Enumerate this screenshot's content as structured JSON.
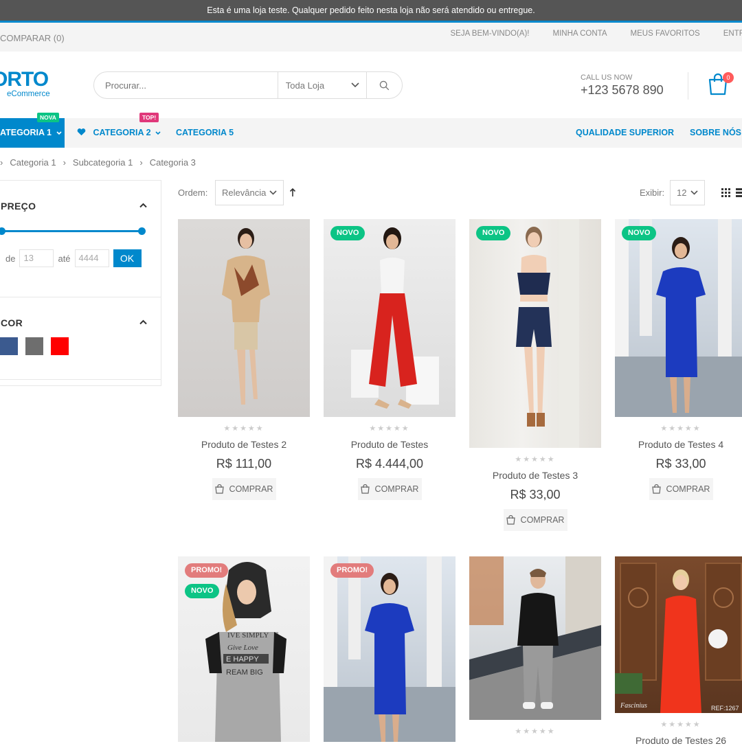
{
  "notice": "Esta é uma loja teste. Qualquer pedido feito nesta loja não será atendido ou entregue.",
  "topbar": {
    "compare": "COMPARAR (0)",
    "links": [
      "SEJA BEM-VINDO(A)!",
      "MINHA CONTA",
      "MEUS FAVORITOS",
      "ENTRAR"
    ]
  },
  "header": {
    "logo_word": "ORTO",
    "logo_sub": "eCommerce",
    "search_placeholder": "Procurar...",
    "search_scope": "Toda Loja",
    "call_label": "CALL US NOW",
    "call_number": "+123 5678 890",
    "cart_count": "0"
  },
  "nav": {
    "items": [
      {
        "label": "ATEGORIA 1",
        "tag": "NOVA",
        "tag_color": "#0cc485"
      },
      {
        "label": "CATEGORIA 2",
        "tag": "TOP!",
        "tag_color": "#e36159"
      },
      {
        "label": "CATEGORIA 5"
      }
    ],
    "right": [
      "QUALIDADE SUPERIOR",
      "SOBRE NÓS"
    ]
  },
  "breadcrumb": [
    "Categoria 1",
    "Subcategoria 1",
    "Categoria 3"
  ],
  "sidebar": {
    "price_title": "PREÇO",
    "from_label": "de",
    "from_value": "13",
    "to_label": "até",
    "to_value": "4444",
    "ok_label": "OK",
    "color_title": "COR",
    "colors": [
      "#3b5a8f",
      "#6e6e6e",
      "#ff0000"
    ]
  },
  "toolbar": {
    "order_label": "Ordem:",
    "order_value": "Relevância",
    "show_label": "Exibir:",
    "show_value": "12"
  },
  "products": [
    {
      "name": "Produto de Testes 2",
      "price": "R$ 111,00",
      "buy": "COMPRAR",
      "badges": []
    },
    {
      "name": "Produto de Testes",
      "price": "R$ 4.444,00",
      "buy": "COMPRAR",
      "badges": [
        "NOVO"
      ]
    },
    {
      "name": "Produto de Testes 3",
      "price": "R$ 33,00",
      "buy": "COMPRAR",
      "badges": [
        "NOVO"
      ]
    },
    {
      "name": "Produto de Testes 4",
      "price": "R$ 33,00",
      "buy": "COMPRAR",
      "badges": [
        "NOVO"
      ]
    }
  ],
  "products_row2": [
    {
      "badges": [
        "PROMO!",
        "NOVO"
      ]
    },
    {
      "badges": [
        "PROMO!"
      ]
    },
    {
      "badges": []
    },
    {
      "name": "Produto de Testes 26",
      "badges": []
    }
  ],
  "colors": {
    "accent": "#0088cc",
    "novo": "#0cc485",
    "promo": "#e27c7c"
  }
}
